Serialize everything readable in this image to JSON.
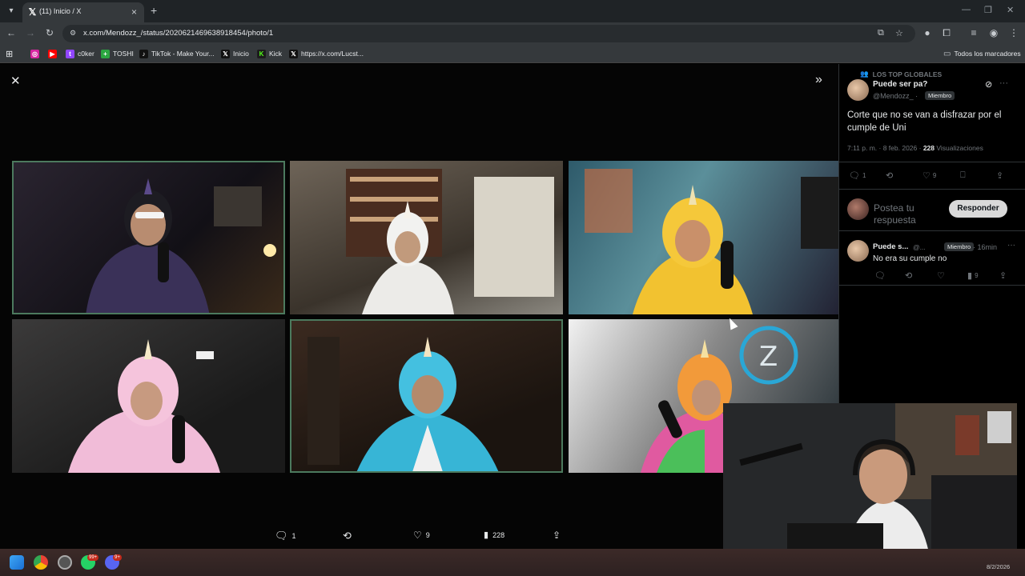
{
  "browser": {
    "tab_title": "(11) Inicio / X",
    "tab_favicon": "x-logo-icon",
    "url": "x.com/Mendozz_/status/2020621469638918454/photo/1",
    "bookmarks": [
      {
        "label": "",
        "icon": "instagram-icon",
        "color": "#d6249f"
      },
      {
        "label": "",
        "icon": "youtube-icon",
        "color": "#ff0000"
      },
      {
        "label": "c0ker",
        "icon": "twitch-icon",
        "color": "#9146ff"
      },
      {
        "label": "TOSHI",
        "icon": "cross-icon",
        "color": "#2ba640"
      },
      {
        "label": "TikTok - Make Your...",
        "icon": "tiktok-icon",
        "color": "#000000"
      },
      {
        "label": "Inicio",
        "icon": "x-logo-icon",
        "color": "#000000"
      },
      {
        "label": "Kick",
        "icon": "kick-icon",
        "color": "#53fc18"
      },
      {
        "label": "https://x.com/Lucst...",
        "icon": "x-logo-icon",
        "color": "#000000"
      }
    ],
    "all_bookmarks_label": "Todos los marcadores"
  },
  "photo_actions": {
    "replies": "1",
    "reposts": "",
    "likes": "9",
    "views": "228"
  },
  "panel": {
    "community": "LOS TOP GLOBALES",
    "author_name": "Puede ser pa?",
    "author_handle": "@Mendozz_ ·",
    "member_badge": "Miembro",
    "post_text": "Corte que no se van a disfrazar por el cumple de Uni",
    "post_time": "7:11 p. m. · 8 feb. 2026 ·",
    "views_count": "228",
    "views_label": "Visualizaciones",
    "replies": "1",
    "likes": "9",
    "reply_placeholder": "Postea tu respuesta",
    "reply_button": "Responder",
    "comment": {
      "name": "Puede s...",
      "handle": "@...",
      "badge": "Miembro",
      "time": "· 16min",
      "text": "No era su cumple no",
      "views": "9"
    }
  },
  "taskbar": {
    "whatsapp_badge": "99+",
    "discord_badge": "9+",
    "clock_date": "8/2/2026"
  },
  "colors": {
    "x_background": "#000000",
    "border": "#2f3336",
    "muted_text": "#71767b",
    "active_cell_border": "#4c7a5e"
  }
}
